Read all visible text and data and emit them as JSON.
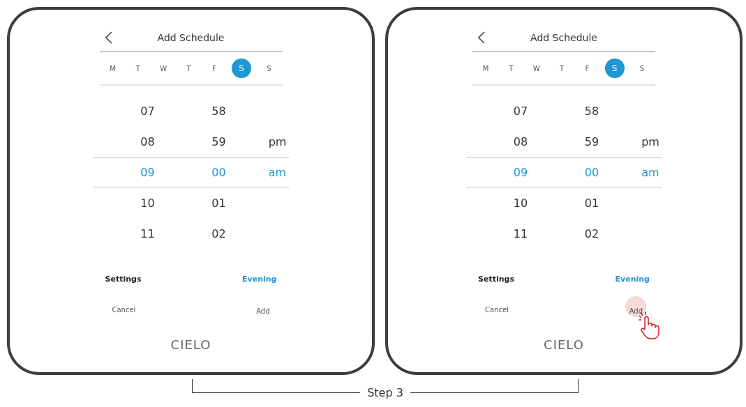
{
  "panels": [
    {
      "title": "Add Schedule",
      "days": [
        {
          "label": "M",
          "selected": false
        },
        {
          "label": "T",
          "selected": false
        },
        {
          "label": "W",
          "selected": false
        },
        {
          "label": "T",
          "selected": false
        },
        {
          "label": "F",
          "selected": false
        },
        {
          "label": "S",
          "selected": true
        },
        {
          "label": "S",
          "selected": false
        }
      ],
      "rows": [
        {
          "hour": "07",
          "minute": "58",
          "selected": false
        },
        {
          "hour": "08",
          "minute": "59",
          "period": "pm",
          "selected": false
        },
        {
          "hour": "09",
          "minute": "00",
          "period": "am",
          "selected": true
        },
        {
          "hour": "10",
          "minute": "01",
          "selected": false
        },
        {
          "hour": "11",
          "minute": "02",
          "selected": false
        }
      ],
      "settings_label": "Settings",
      "settings_value": "Evening",
      "cancel": "Cancel",
      "add": "Add",
      "logo": "CIELO",
      "tap_hint": false
    },
    {
      "title": "Add Schedule",
      "days": [
        {
          "label": "M",
          "selected": false
        },
        {
          "label": "T",
          "selected": false
        },
        {
          "label": "W",
          "selected": false
        },
        {
          "label": "T",
          "selected": false
        },
        {
          "label": "F",
          "selected": false
        },
        {
          "label": "S",
          "selected": true
        },
        {
          "label": "S",
          "selected": false
        }
      ],
      "rows": [
        {
          "hour": "07",
          "minute": "58",
          "selected": false
        },
        {
          "hour": "08",
          "minute": "59",
          "period": "pm",
          "selected": false
        },
        {
          "hour": "09",
          "minute": "00",
          "period": "am",
          "selected": true
        },
        {
          "hour": "10",
          "minute": "01",
          "selected": false
        },
        {
          "hour": "11",
          "minute": "02",
          "selected": false
        }
      ],
      "settings_label": "Settings",
      "settings_value": "Evening",
      "cancel": "Cancel",
      "add": "Add",
      "logo": "CIELO",
      "tap_hint": true
    }
  ],
  "caption": "Step 3"
}
